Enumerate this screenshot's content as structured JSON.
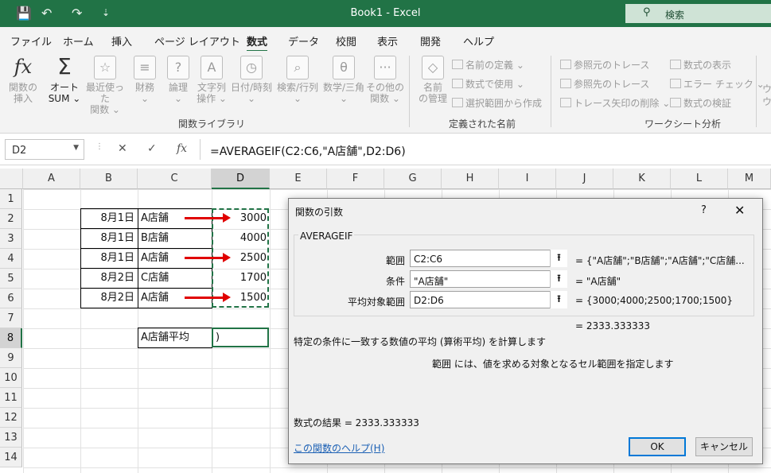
{
  "titlebar": {
    "title": "Book1  -  Excel",
    "search_placeholder": "検索",
    "save_icon": "💾",
    "undo_icon": "↶",
    "redo_icon": "↷",
    "customize_icon": "⇣"
  },
  "tabs": [
    "ファイル",
    "ホーム",
    "挿入",
    "ページ レイアウト",
    "数式",
    "データ",
    "校閲",
    "表示",
    "開発",
    "ヘルプ"
  ],
  "active_tab": "数式",
  "ribbon": {
    "insert_function": {
      "line1": "関数の",
      "line2": "挿入"
    },
    "autosum": {
      "line1": "オート",
      "line2": "SUM ⌄"
    },
    "recent": {
      "line1": "最近使った",
      "line2": "関数 ⌄"
    },
    "financial": {
      "line1": "財務",
      "line2": "⌄"
    },
    "logical": {
      "line1": "論理",
      "line2": "⌄"
    },
    "text": {
      "line1": "文字列",
      "line2": "操作 ⌄"
    },
    "datetime": {
      "line1": "日付/時刻",
      "line2": "⌄"
    },
    "lookup": {
      "line1": "検索/行列",
      "line2": "⌄"
    },
    "math": {
      "line1": "数学/三角",
      "line2": "⌄"
    },
    "more": {
      "line1": "その他の",
      "line2": "関数 ⌄"
    },
    "group_library": "関数ライブラリ",
    "name_manager": {
      "line1": "名前",
      "line2": "の管理"
    },
    "define_name": "名前の定義  ⌄",
    "use_in_formula": "数式で使用 ⌄",
    "create_from_selection": "選択範囲から作成",
    "group_names": "定義された名前",
    "trace_precedents": "参照元のトレース",
    "trace_dependents": "参照先のトレース",
    "remove_arrows": "トレース矢印の削除  ⌄",
    "show_formulas": "数式の表示",
    "error_checking": "エラー チェック  ⌄",
    "evaluate_formula": "数式の検証",
    "group_audit": "ワークシート分析",
    "watch": {
      "line1": "ウ",
      "line2": "ウィ"
    }
  },
  "formula_bar": {
    "name_box": "D2",
    "cancel_icon": "✕",
    "enter_icon": "✓",
    "fx_icon": "fx",
    "formula": "=AVERAGEIF(C2:C6,\"A店舗\",D2:D6)"
  },
  "grid": {
    "columns": [
      "A",
      "B",
      "C",
      "D",
      "E",
      "F",
      "G",
      "H",
      "I",
      "J",
      "K",
      "L",
      "M"
    ],
    "rows": [
      "1",
      "2",
      "3",
      "4",
      "5",
      "6",
      "7",
      "8",
      "9",
      "10",
      "11",
      "12",
      "13",
      "14"
    ],
    "data": [
      {
        "date": "8月1日",
        "store": "A店舗",
        "value": "3000"
      },
      {
        "date": "8月1日",
        "store": "B店舗",
        "value": "4000"
      },
      {
        "date": "8月1日",
        "store": "A店舗",
        "value": "2500"
      },
      {
        "date": "8月2日",
        "store": "C店舗",
        "value": "1700"
      },
      {
        "date": "8月2日",
        "store": "A店舗",
        "value": "1500"
      }
    ],
    "c8": "A店舗平均",
    "d8": ")"
  },
  "dialog": {
    "title": "関数の引数",
    "help_icon": "?",
    "close_icon": "✕",
    "function_name": "AVERAGEIF",
    "args": [
      {
        "label": "範囲",
        "value": "C2:C6",
        "result": "=   {\"A店舗\";\"B店舗\";\"A店舗\";\"C店舗..."
      },
      {
        "label": "条件",
        "value": "\"A店舗\"",
        "result": "=   \"A店舗\""
      },
      {
        "label": "平均対象範囲",
        "value": "D2:D6",
        "result": "=   {3000;4000;2500;1700;1500}"
      }
    ],
    "collapse_icon": "⭱",
    "total": "=   2333.333333",
    "description": "特定の条件に一致する数値の平均 (算術平均) を計算します",
    "arg_help": "範囲   には、値を求める対象となるセル範囲を指定します",
    "result_line": "数式の結果 =   2333.333333",
    "help_link": "この関数のヘルプ(H)",
    "ok": "OK",
    "cancel": "キャンセル"
  }
}
